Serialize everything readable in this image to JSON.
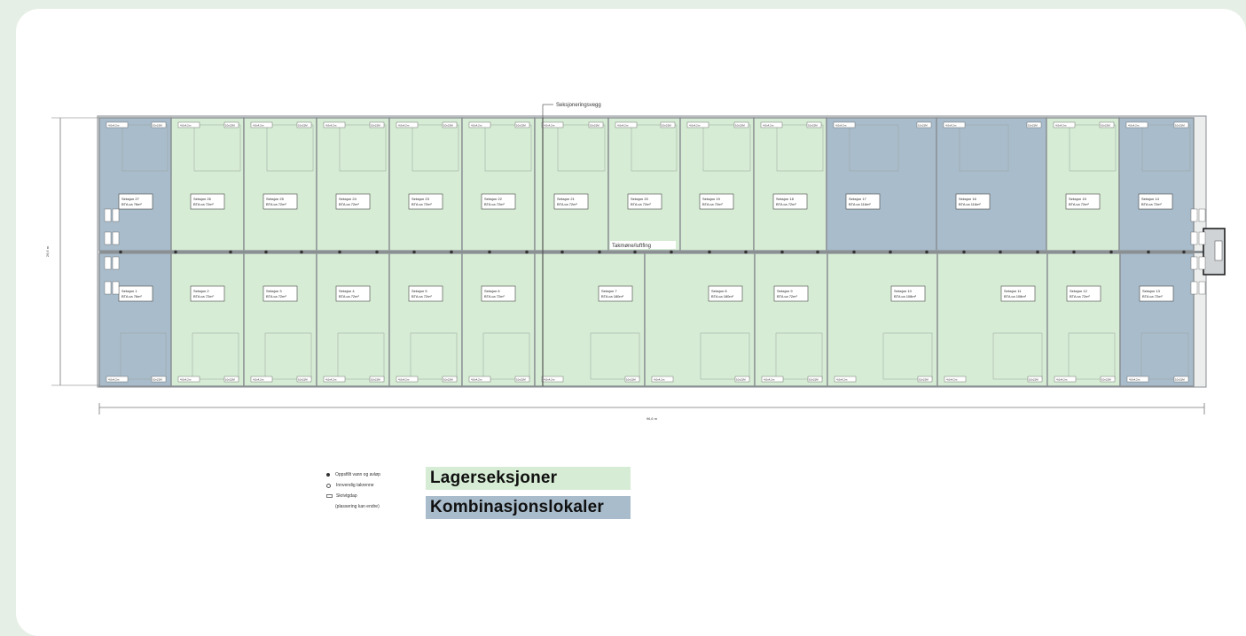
{
  "annotations": {
    "section_wall": "Seksjoneringsvegg",
    "ridge": "Takmøne/luftfing",
    "width_dim": "96,6 m",
    "depth_dim": "26,6 m"
  },
  "colors": {
    "storage": "#d6ecd4",
    "combo": "#a9bccb",
    "wall": "#8a8f93"
  },
  "labels": {
    "door": "4,0x4,2m",
    "window": "10x21M",
    "section_prefix": "Seksjon",
    "bta_prefix": "BTA ca"
  },
  "top_row": [
    {
      "n": "27",
      "bta": "76m²",
      "type": "combo"
    },
    {
      "n": "26",
      "bta": "72m²",
      "type": "storage"
    },
    {
      "n": "25",
      "bta": "72m²",
      "type": "storage"
    },
    {
      "n": "24",
      "bta": "72m²",
      "type": "storage"
    },
    {
      "n": "23",
      "bta": "72m²",
      "type": "storage"
    },
    {
      "n": "22",
      "bta": "72m²",
      "type": "storage"
    },
    {
      "n": "21",
      "bta": "72m²",
      "type": "storage"
    },
    {
      "n": "20",
      "bta": "72m²",
      "type": "storage"
    },
    {
      "n": "19",
      "bta": "72m²",
      "type": "storage"
    },
    {
      "n": "18",
      "bta": "72m²",
      "type": "storage"
    },
    {
      "n": "17",
      "bta": "116m²",
      "type": "combo"
    },
    {
      "n": "16",
      "bta": "116m²",
      "type": "combo"
    },
    {
      "n": "15",
      "bta": "72m²",
      "type": "storage"
    },
    {
      "n": "14",
      "bta": "72m²",
      "type": "combo"
    }
  ],
  "bottom_row": [
    {
      "n": "1",
      "bta": "76m²",
      "type": "combo"
    },
    {
      "n": "2",
      "bta": "72m²",
      "type": "storage"
    },
    {
      "n": "3",
      "bta": "72m²",
      "type": "storage"
    },
    {
      "n": "4",
      "bta": "72m²",
      "type": "storage"
    },
    {
      "n": "5",
      "bta": "72m²",
      "type": "storage"
    },
    {
      "n": "6",
      "bta": "72m²",
      "type": "storage"
    },
    {
      "n": "7",
      "bta": "180m²",
      "type": "storage"
    },
    {
      "n": "8",
      "bta": "180m²",
      "type": "storage"
    },
    {
      "n": "9",
      "bta": "72m²",
      "type": "storage"
    },
    {
      "n": "10",
      "bta": "108m²",
      "type": "storage"
    },
    {
      "n": "11",
      "bta": "108m²",
      "type": "storage"
    },
    {
      "n": "12",
      "bta": "72m²",
      "type": "storage"
    },
    {
      "n": "13",
      "bta": "72m²",
      "type": "combo"
    }
  ],
  "legend": {
    "items": [
      "Oppsfillt vann og avløp",
      "Innvendig takrenne",
      "Skrivtgdap",
      "(plassering kan endre)"
    ],
    "storage_label": "Lagerseksjoner",
    "combo_label": "Kombinasjonslokaler"
  }
}
